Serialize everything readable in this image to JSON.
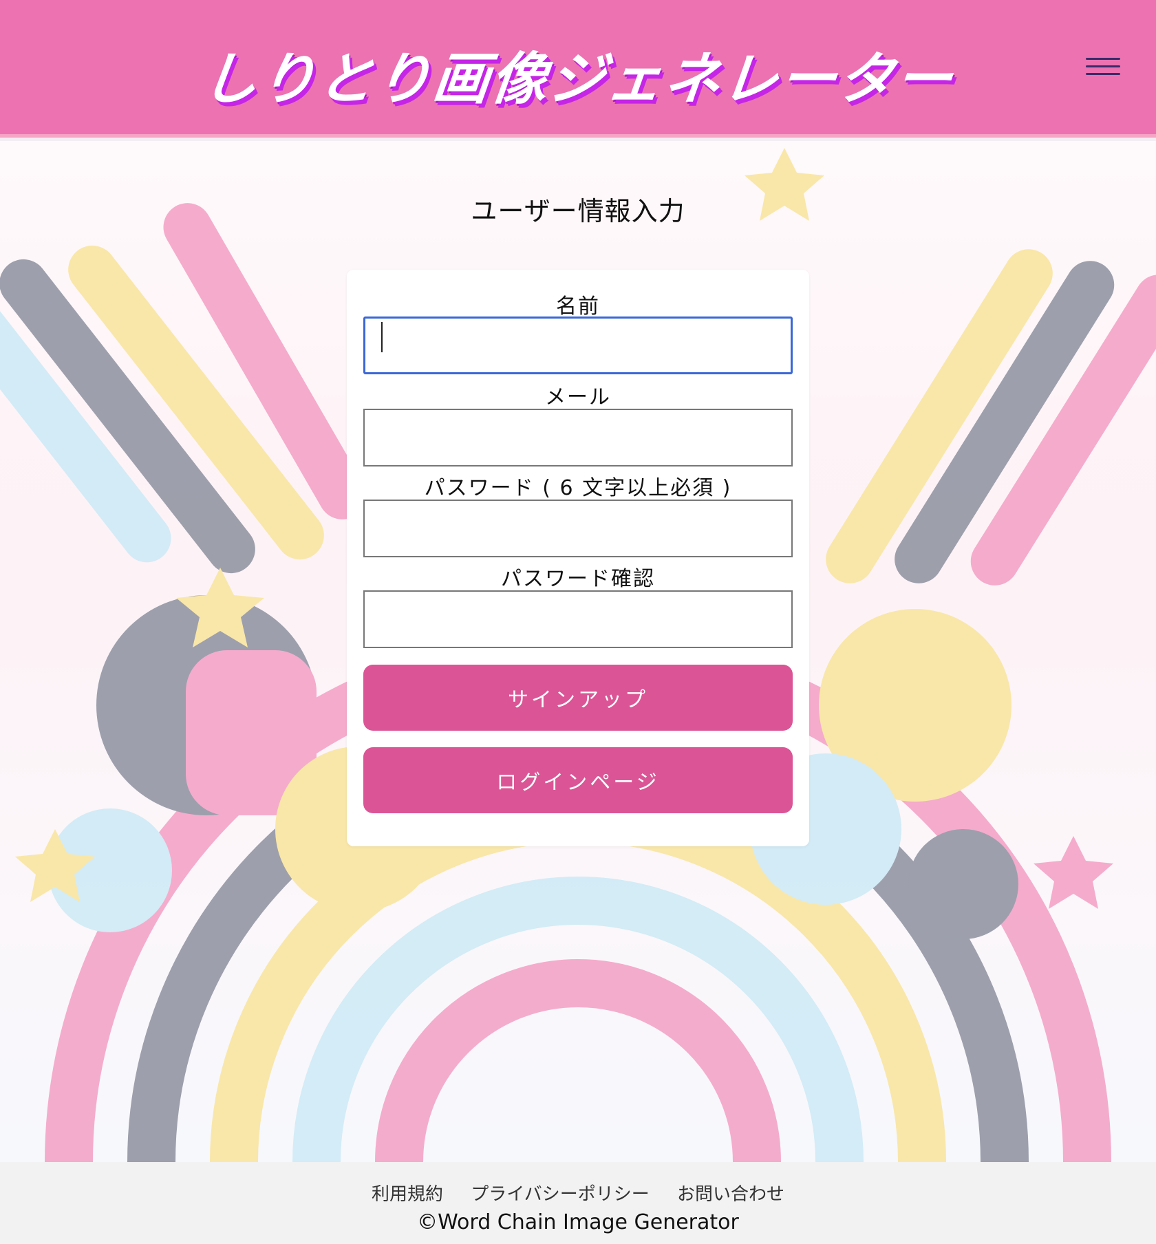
{
  "header": {
    "title": "しりとり画像ジェネレーター",
    "menu_icon": "hamburger-menu-icon"
  },
  "main": {
    "heading": "ユーザー情報入力",
    "fields": [
      {
        "label": "名前",
        "value": ""
      },
      {
        "label": "メール",
        "value": ""
      },
      {
        "label": "パスワード ( 6 文字以上必須 )",
        "value": ""
      },
      {
        "label": "パスワード確認",
        "value": ""
      }
    ],
    "signup_button": "サインアップ",
    "login_button": "ログインページ"
  },
  "footer": {
    "links": [
      "利用規約",
      "プライバシーポリシー",
      "お問い合わせ"
    ],
    "copyright": "©Word Chain Image Generator"
  },
  "colors": {
    "header_bg": "#ec72b2",
    "button_bg": "#db5596",
    "focus_border": "#3a67d8",
    "footer_bg": "#f2f2f2"
  }
}
